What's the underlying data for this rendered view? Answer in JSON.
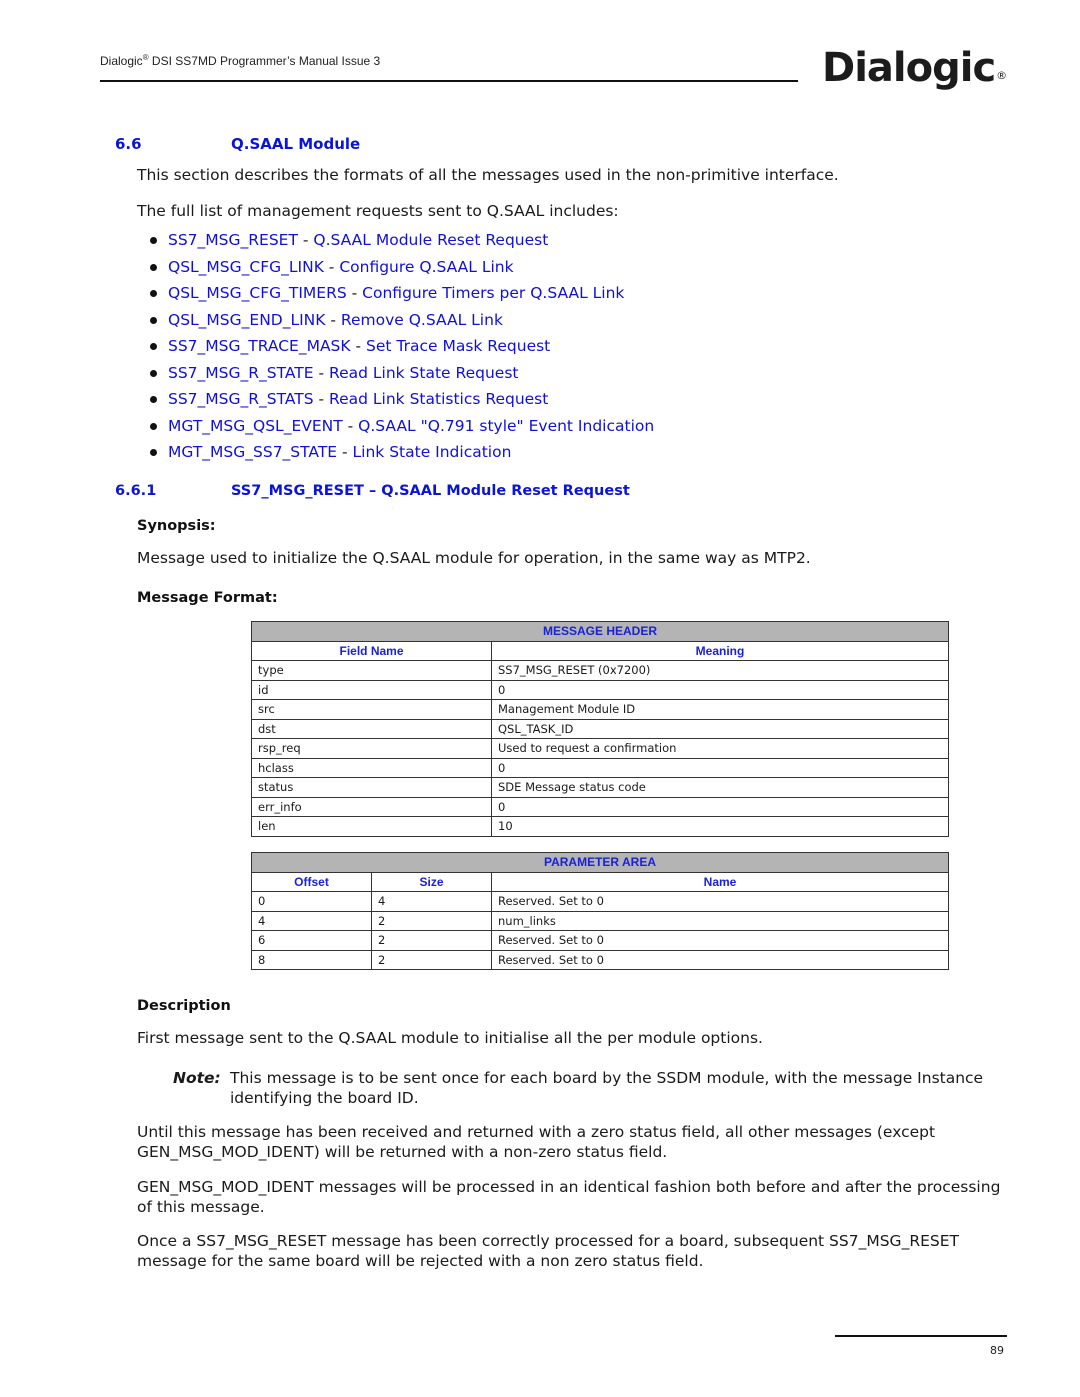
{
  "header": {
    "manual_title_prefix": "Dialogic",
    "manual_title_reg": "®",
    "manual_title_suffix": " DSI SS7MD Programmer’s Manual  Issue 3",
    "logo_text": "Dialogic",
    "logo_reg": "®"
  },
  "section": {
    "number": "6.6",
    "title": "Q.SAAL Module",
    "intro": "This section describes the formats of all the messages used in the non-primitive interface.",
    "list_intro": "The full list of management requests sent to Q.SAAL includes:",
    "requests": [
      {
        "name": "SS7_MSG_RESET",
        "sep": " - ",
        "desc": "Q.SAAL Module Reset Request"
      },
      {
        "name": "QSL_MSG_CFG_LINK",
        "sep": " - ",
        "desc": "Configure Q.SAAL Link"
      },
      {
        "name": "QSL_MSG_CFG_TIMERS",
        "sep": " - ",
        "desc": "Configure Timers per Q.SAAL Link"
      },
      {
        "name": "QSL_MSG_END_LINK",
        "sep": " - ",
        "desc": "Remove Q.SAAL Link"
      },
      {
        "name": "SS7_MSG_TRACE_MASK",
        "sep": " - ",
        "desc": "Set Trace Mask Request"
      },
      {
        "name": "SS7_MSG_R_STATE",
        "sep": " - ",
        "desc": "Read Link State Request"
      },
      {
        "name": "SS7_MSG_R_STATS",
        "sep": " - ",
        "desc": "Read Link Statistics Request"
      },
      {
        "name": "MGT_MSG_QSL_EVENT",
        "sep": " - ",
        "desc": "Q.SAAL \"Q.791 style\" Event Indication"
      },
      {
        "name": "MGT_MSG_SS7_STATE",
        "sep": " - ",
        "desc": "Link State Indication"
      }
    ]
  },
  "subsection": {
    "number": "6.6.1",
    "title": "SS7_MSG_RESET – Q.SAAL Module Reset Request",
    "synopsis_label": "Synopsis:",
    "synopsis": "Message used to initialize the Q.SAAL module for operation, in the same way as MTP2.",
    "format_label": "Message Format:",
    "message_header": {
      "title": "MESSAGE HEADER",
      "columns": [
        "Field Name",
        "Meaning"
      ],
      "rows": [
        [
          "type",
          "SS7_MSG_RESET (0x7200)"
        ],
        [
          "id",
          "0"
        ],
        [
          "src",
          "Management Module ID"
        ],
        [
          "dst",
          "QSL_TASK_ID"
        ],
        [
          "rsp_req",
          "Used to request a confirmation"
        ],
        [
          "hclass",
          "0"
        ],
        [
          "status",
          "SDE Message status code"
        ],
        [
          "err_info",
          "0"
        ],
        [
          "len",
          "10"
        ]
      ]
    },
    "parameter_area": {
      "title": "PARAMETER AREA",
      "columns": [
        "Offset",
        "Size",
        "Name"
      ],
      "rows": [
        [
          "0",
          "4",
          "Reserved. Set to 0"
        ],
        [
          "4",
          "2",
          "num_links"
        ],
        [
          "6",
          "2",
          "Reserved. Set to 0"
        ],
        [
          "8",
          "2",
          "Reserved. Set to 0"
        ]
      ]
    },
    "description_label": "Description",
    "description": "First message sent to the Q.SAAL module to initialise all the per module options.",
    "note_label": "Note:",
    "note": "This message is to be sent once for each board by the SSDM module, with the message Instance identifying the board ID.",
    "paragraphs": [
      "Until this message has been received and returned with a zero status field, all other messages (except GEN_MSG_MOD_IDENT) will be returned with a non-zero status field.",
      "GEN_MSG_MOD_IDENT messages will be processed in an identical fashion both before and after the processing of this message.",
      "Once a SS7_MSG_RESET message has been correctly processed for a board, subsequent SS7_MSG_RESET message for the same board will be rejected with a non zero status field."
    ]
  },
  "footer": {
    "page_number": "89"
  }
}
